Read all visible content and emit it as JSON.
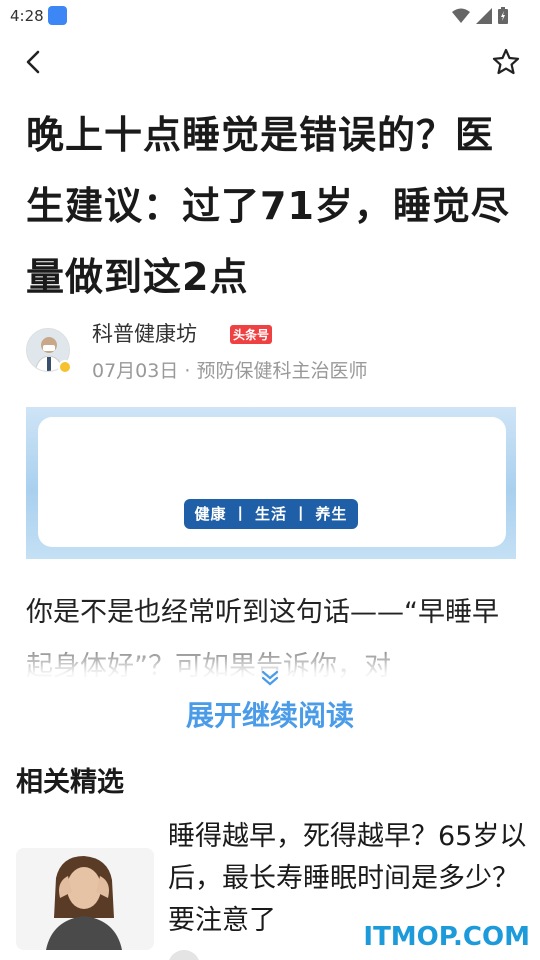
{
  "status_bar": {
    "time": "4:28"
  },
  "article": {
    "title": "晚上十点睡觉是错误的？医生建议：过了71岁，睡觉尽量做到这2点",
    "author": {
      "name": "科普健康坊",
      "badge": "头条号",
      "meta": "07月03日 · 预防保健科主治医师"
    },
    "banner_tag": "健康 丨 生活 丨 养生",
    "body": "你是不是也经常听到这句话——“早睡早起身体好”？可如果告诉你，对",
    "expand_label": "展开继续阅读"
  },
  "related": {
    "heading": "相关精选",
    "items": [
      {
        "title": "睡得越早，死得越早？65岁以后，最长寿睡眠时间是多少？要注意了"
      }
    ]
  },
  "watermark": "ITMOP.COM",
  "icons": {
    "back": "back-arrow-icon",
    "favorite": "star-icon",
    "wifi": "wifi-icon",
    "signal": "signal-icon",
    "battery": "battery-icon",
    "expand": "chevron-down-double-icon"
  },
  "colors": {
    "accent": "#4a9be8",
    "badge": "#f04142",
    "watermark": "#1d9ad9"
  }
}
